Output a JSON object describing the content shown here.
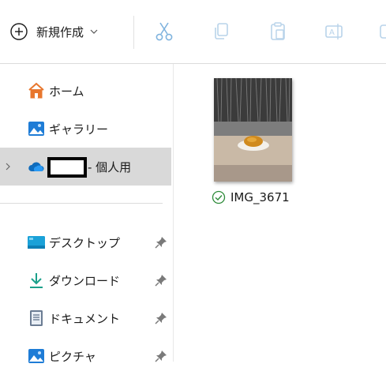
{
  "toolbar": {
    "new_label": "新規作成",
    "buttons": [
      {
        "name": "cut",
        "icon": "scissors-icon"
      },
      {
        "name": "copy",
        "icon": "copy-icon"
      },
      {
        "name": "paste",
        "icon": "clipboard-icon"
      },
      {
        "name": "rename",
        "icon": "rename-icon"
      },
      {
        "name": "share",
        "icon": "share-icon"
      }
    ]
  },
  "sidebar": {
    "items": [
      {
        "label": "ホーム",
        "icon": "home-icon"
      },
      {
        "label": "ギャラリー",
        "icon": "gallery-icon"
      },
      {
        "label": "- 個人用",
        "icon": "onedrive-cloud-icon",
        "selected": true
      },
      {
        "label": "デスクトップ",
        "icon": "desktop-icon",
        "pinned": true
      },
      {
        "label": "ダウンロード",
        "icon": "download-icon",
        "pinned": true
      },
      {
        "label": "ドキュメント",
        "icon": "documents-icon",
        "pinned": true
      },
      {
        "label": "ピクチャ",
        "icon": "pictures-icon",
        "pinned": true
      }
    ]
  },
  "content": {
    "files": [
      {
        "name": "IMG_3671",
        "status": "synced",
        "status_icon": "check-circle-icon"
      }
    ]
  },
  "colors": {
    "selected_bg": "#d9d9d9",
    "accent_blue": "#0f6cbd",
    "synced_green": "#2e8b3a",
    "home_orange": "#e8772e"
  }
}
